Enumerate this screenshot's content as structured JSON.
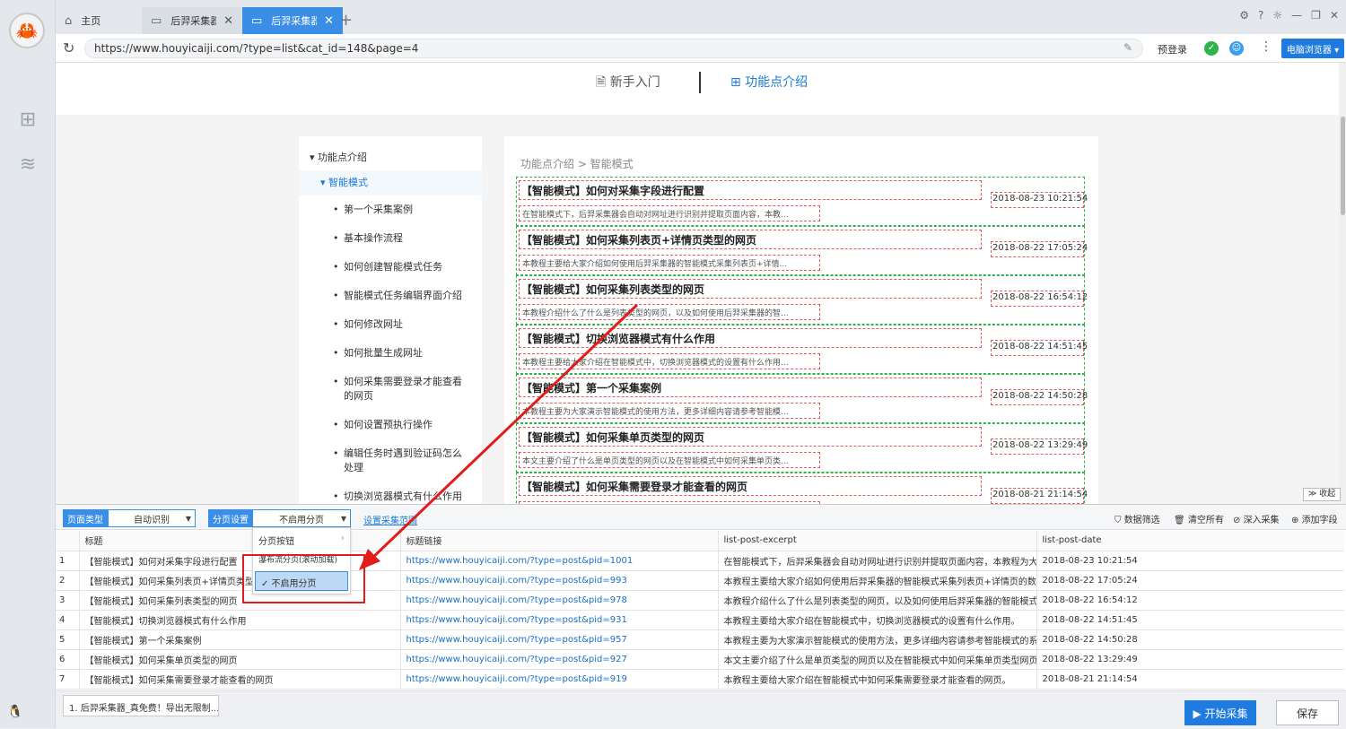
{
  "browser": {
    "tabs": [
      {
        "label": "主页"
      },
      {
        "label": "后羿采集器..."
      },
      {
        "label": "后羿采集器..."
      }
    ],
    "new_tab": "+",
    "url": "https://www.houyicaiji.com/?type=list&cat_id=148&page=4",
    "prelogin": "预登录",
    "mode_button": "电脑浏览器 ▾",
    "window_controls": [
      "⚙",
      "?",
      "☼",
      "—",
      "❐",
      "✕"
    ]
  },
  "site": {
    "nav_guide": "🗎 新手入门",
    "nav_features": "⊞ 功能点介绍",
    "sidebar": {
      "root": "▾ 功能点介绍",
      "section": "▾ 智能模式",
      "items": [
        "第一个采集案例",
        "基本操作流程",
        "如何创建智能模式任务",
        "智能模式任务编辑界面介绍",
        "如何修改网址",
        "如何批量生成网址",
        "如何采集需要登录才能查看的网页",
        "如何设置预执行操作",
        "编辑任务时遇到验证码怎么处理",
        "切换浏览器模式有什么作用"
      ]
    },
    "breadcrumb": "功能点介绍 > 智能模式",
    "articles": [
      {
        "title": "【智能模式】如何对采集字段进行配置",
        "date": "2018-08-23 10:21:54",
        "excerpt": "在智能模式下，后羿采集器会自动对网址进行识别并提取页面内容，本教..."
      },
      {
        "title": "【智能模式】如何采集列表页+详情页类型的网页",
        "date": "2018-08-22 17:05:24",
        "excerpt": "本教程主要给大家介绍如何使用后羿采集器的智能模式采集列表页+详情..."
      },
      {
        "title": "【智能模式】如何采集列表类型的网页",
        "date": "2018-08-22 16:54:12",
        "excerpt": "本教程介绍什么了什么是列表类型的网页，以及如何使用后羿采集器的智..."
      },
      {
        "title": "【智能模式】切换浏览器模式有什么作用",
        "date": "2018-08-22 14:51:45",
        "excerpt": "本教程主要给大家介绍在智能模式中，切换浏览器模式的设置有什么作用..."
      },
      {
        "title": "【智能模式】第一个采集案例",
        "date": "2018-08-22 14:50:28",
        "excerpt": "本教程主要为大家演示智能模式的使用方法，更多详细内容请参考智能模..."
      },
      {
        "title": "【智能模式】如何采集单页类型的网页",
        "date": "2018-08-22 13:29:49",
        "excerpt": "本文主要介绍了什么是单页类型的网页以及在智能模式中如何采集单页类..."
      },
      {
        "title": "【智能模式】如何采集需要登录才能查看的网页",
        "date": "2018-08-21 21:14:54",
        "excerpt": ""
      }
    ],
    "collapse": "≫ 收起"
  },
  "panel": {
    "page_type_label": "页面类型",
    "page_type_value": "自动识别",
    "paging_label": "分页设置",
    "paging_value": "不启用分页",
    "set_range": "设置采集范围",
    "tools": [
      "数据筛选",
      "清空所有",
      "深入采集",
      "添加字段"
    ],
    "dropdown": [
      "分页按钮",
      "瀑布流分页(滚动加载)",
      "✓ 不启用分页"
    ],
    "columns": [
      "",
      "标题",
      "标题链接",
      "list-post-excerpt",
      "list-post-date"
    ],
    "rows": [
      [
        "1",
        "【智能模式】如何对采集字段进行配置",
        "https://www.houyicaiji.com/?type=post&pid=1001",
        "在智能模式下，后羿采集器会自动对网址进行识别并提取页面内容，本教程为大家...",
        "2018-08-23 10:21:54"
      ],
      [
        "2",
        "【智能模式】如何采集列表页+详情页类型的网页",
        "https://www.houyicaiji.com/?type=post&pid=993",
        "本教程主要给大家介绍如何使用后羿采集器的智能模式采集列表页+详情页的数据。",
        "2018-08-22 17:05:24"
      ],
      [
        "3",
        "【智能模式】如何采集列表类型的网页",
        "https://www.houyicaiji.com/?type=post&pid=978",
        "本教程介绍什么了什么是列表类型的网页，以及如何使用后羿采集器的智能模式采...",
        "2018-08-22 16:54:12"
      ],
      [
        "4",
        "【智能模式】切换浏览器模式有什么作用",
        "https://www.houyicaiji.com/?type=post&pid=931",
        "本教程主要给大家介绍在智能模式中，切换浏览器模式的设置有什么作用。",
        "2018-08-22 14:51:45"
      ],
      [
        "5",
        "【智能模式】第一个采集案例",
        "https://www.houyicaiji.com/?type=post&pid=957",
        "本教程主要为大家演示智能模式的使用方法，更多详细内容请参考智能模式的系列...",
        "2018-08-22 14:50:28"
      ],
      [
        "6",
        "【智能模式】如何采集单页类型的网页",
        "https://www.houyicaiji.com/?type=post&pid=927",
        "本文主要介绍了什么是单页类型的网页以及在智能模式中如何采集单页类型网页中...",
        "2018-08-22 13:29:49"
      ],
      [
        "7",
        "【智能模式】如何采集需要登录才能查看的网页",
        "https://www.houyicaiji.com/?type=post&pid=919",
        "本教程主要给大家介绍在智能模式中如何采集需要登录才能查看的网页。",
        "2018-08-21 21:14:54"
      ]
    ],
    "status_message": "1. 后羿采集器_真免费！导出无限制...",
    "start_button": "▶ 开始采集",
    "save_button": "保存"
  },
  "colors": {
    "accent": "#3a8ee6",
    "annotation_red": "#e21b1b",
    "field_green": "#2bb54b"
  }
}
